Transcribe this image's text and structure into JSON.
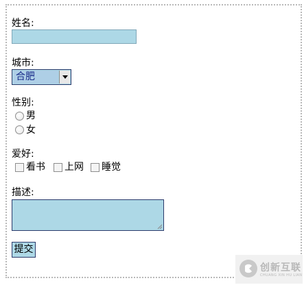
{
  "form": {
    "name_label": "姓名:",
    "name_value": "",
    "city_label": "城市:",
    "city_selected": "合肥",
    "gender_label": "性别:",
    "gender_options": [
      "男",
      "女"
    ],
    "hobby_label": "爱好:",
    "hobby_options": [
      "看书",
      "上网",
      "睡觉"
    ],
    "desc_label": "描述:",
    "desc_value": "",
    "submit_label": "提交"
  },
  "watermark": {
    "text": "创新互联",
    "subtext": "CHUANG XIN HU LIAN"
  },
  "colors": {
    "field_bg": "#add8e6",
    "field_border": "#2b3a6b",
    "frame_border": "#b8b8b8"
  }
}
